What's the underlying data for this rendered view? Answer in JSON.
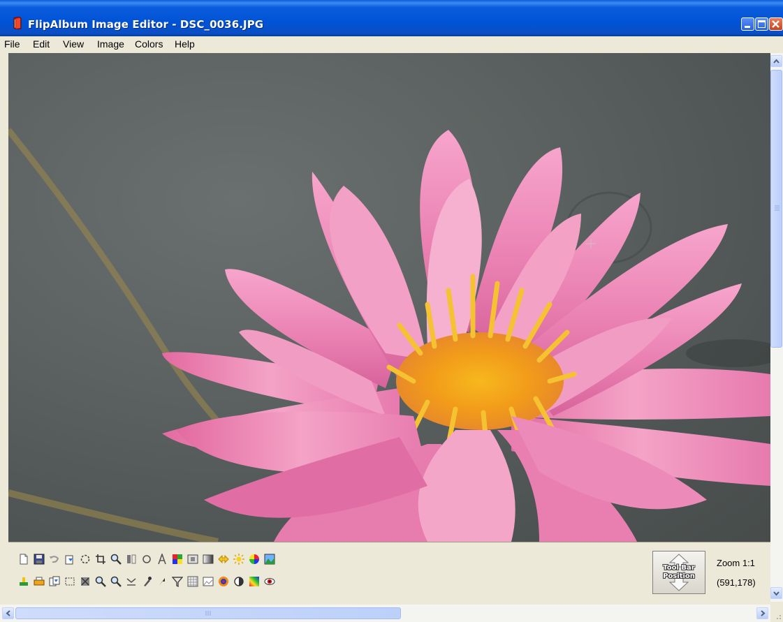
{
  "window": {
    "title": "FlipAlbum Image Editor - DSC_0036.JPG",
    "app_icon": "flipalbum-book-icon",
    "controls": [
      "minimize-icon",
      "maximize-icon",
      "close-icon"
    ],
    "colors": {
      "titlebar": "#0053d6",
      "close": "#c9431c"
    }
  },
  "menu": {
    "items": [
      {
        "label": "File"
      },
      {
        "label": "Edit"
      },
      {
        "label": "View"
      },
      {
        "label": "Image"
      },
      {
        "label": "Colors"
      },
      {
        "label": "Help"
      }
    ]
  },
  "canvas": {
    "content": "pink water lily photo",
    "cursor": "crosshair"
  },
  "toolbar": {
    "row1_icons": [
      "new-page-icon",
      "save-icon",
      "undo-icon",
      "scan-icon",
      "rotate-icon",
      "crop-icon",
      "zoom-icon",
      "flip-icon",
      "rotate-arrows-icon",
      "text-icon",
      "color-swatch-icon",
      "frame-icon",
      "gradient-icon",
      "arrows-icon",
      "brightness-icon",
      "color-wheel-icon",
      "landscape-icon"
    ],
    "row2_icons": [
      "stamp-icon",
      "print-icon",
      "copy-icon",
      "select-icon",
      "cut-icon",
      "zoom-in-icon",
      "zoom-out-icon",
      "resize-icon",
      "eyedropper-icon",
      "sharpen-icon",
      "filter-icon",
      "grid-icon",
      "picture-icon",
      "target-icon",
      "contrast-icon",
      "rainbow-icon",
      "red-eye-icon"
    ],
    "position_button": {
      "label": "Tool Bar Position"
    },
    "zoom_label": "Zoom 1:1",
    "coordinates": "(591,178)"
  },
  "scrollbars": {
    "vertical_position": 0.0,
    "horizontal_position": 0.0
  }
}
